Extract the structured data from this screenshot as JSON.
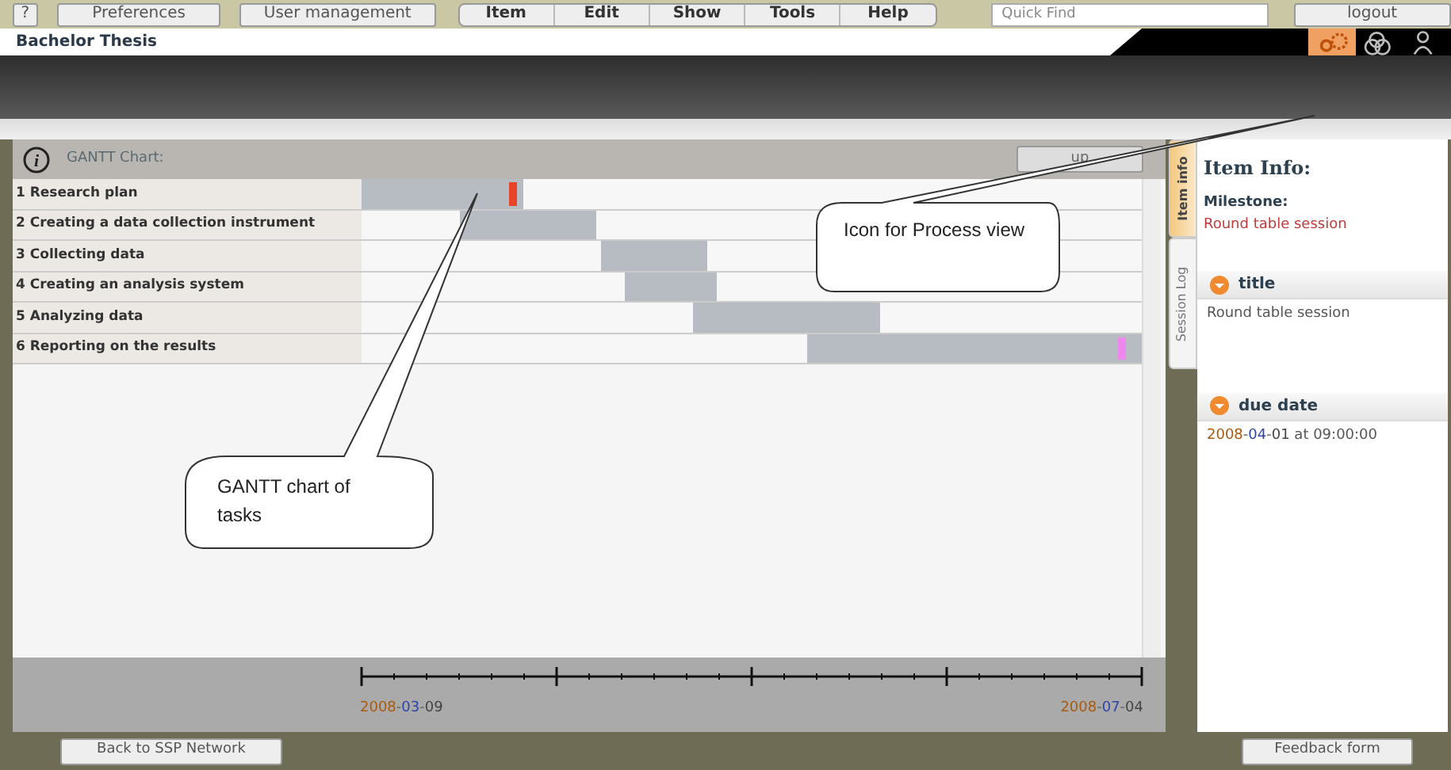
{
  "toolbar": {
    "help": "?",
    "buttons": [
      "Preferences",
      "User management"
    ],
    "menu": [
      "Item",
      "Edit",
      "Show",
      "Tools",
      "Help"
    ],
    "search": {
      "placeholder": "Quick Find"
    },
    "logout": "logout"
  },
  "project": {
    "title": "Bachelor Thesis"
  },
  "views": [
    {
      "kind": "process",
      "selected": true
    },
    {
      "kind": "rings",
      "selected": false
    },
    {
      "kind": "people",
      "selected": false
    }
  ],
  "gantt": {
    "info_icon": "i",
    "title": "GANTT Chart:",
    "button": "up",
    "tasks": [
      {
        "label": "1 Research plan",
        "color": "#e8442a"
      },
      {
        "label": "2 Creating a data collection instrument"
      },
      {
        "label": "3 Collecting data"
      },
      {
        "label": "4 Creating an analysis system"
      },
      {
        "label": "5 Analyzing data"
      },
      {
        "label": "6 Reporting  on the results",
        "color": "#ee88ee"
      }
    ],
    "start_date": "2008-03-09",
    "end_date": "2008-07-04"
  },
  "side_tabs": [
    {
      "label": "Item info",
      "selected": true
    },
    {
      "label": "Session Log",
      "selected": false
    }
  ],
  "item_info": {
    "heading": "Item Info:",
    "type": "Milestone:",
    "name": "Round table session",
    "sections": [
      {
        "title": "title",
        "value": "Round table session",
        "kind": "text"
      },
      {
        "title": "due date",
        "value": "2008-04-01 at 09:00:00",
        "kind": "date"
      }
    ]
  },
  "footer": {
    "left": "Back to SSP Network",
    "right": "Feedback form"
  },
  "callouts": [
    {
      "text": "Icon for Process view"
    },
    {
      "text": "GANTT chart of tasks"
    }
  ]
}
